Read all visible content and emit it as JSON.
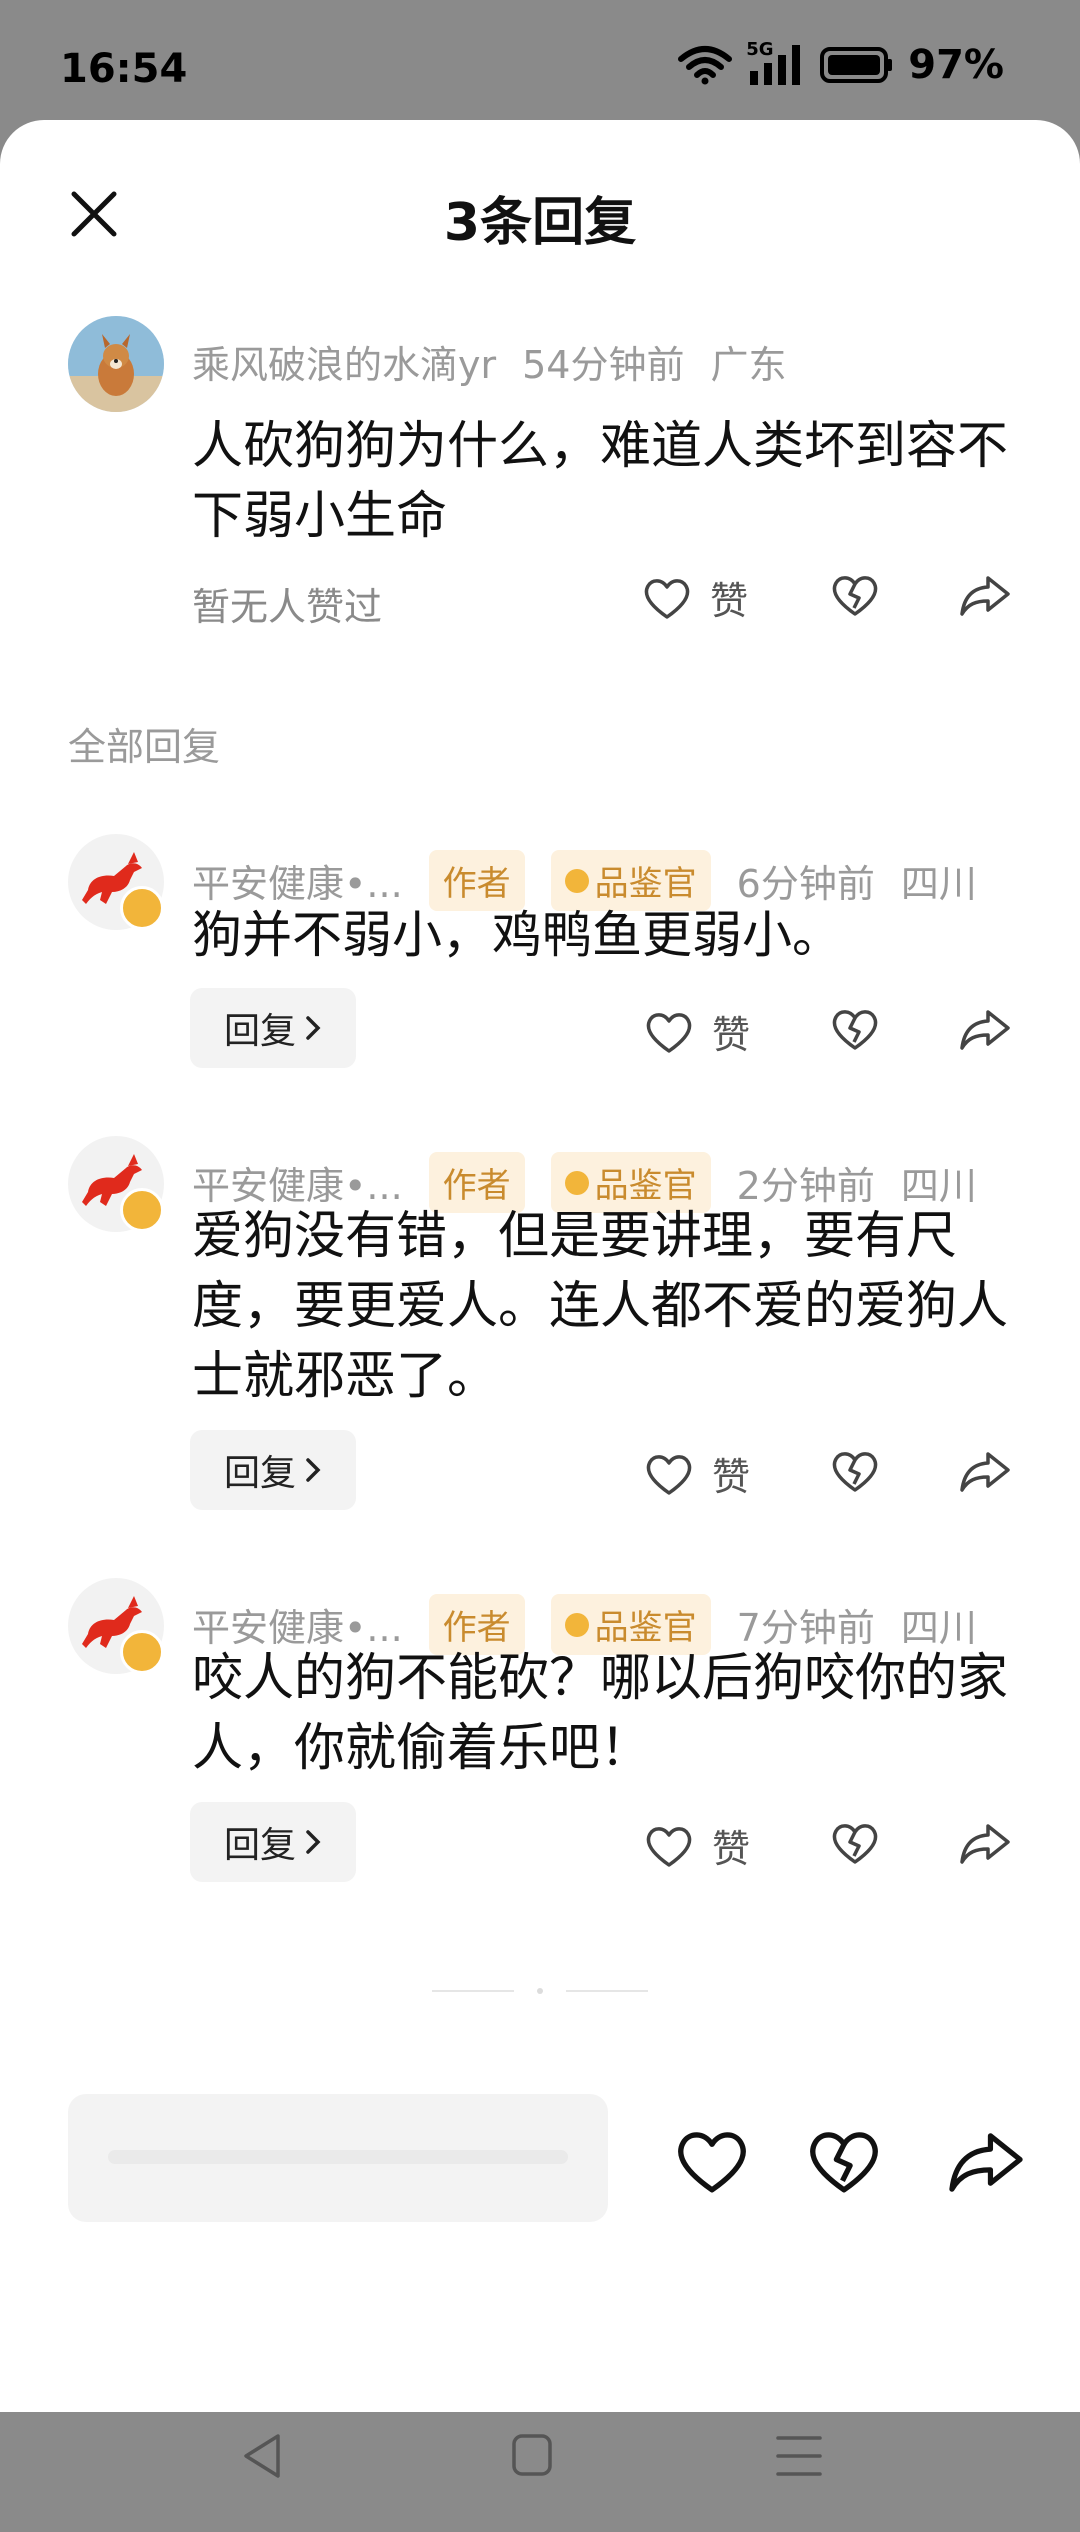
{
  "status": {
    "time": "16:54",
    "network": "5G",
    "battery": "97%"
  },
  "header": {
    "title": "3条回复"
  },
  "main_comment": {
    "user": "乘风破浪的水滴yr",
    "time": "54分钟前",
    "location": "广东",
    "text": "人砍狗狗为什么，难道人类坏到容不下弱小生命",
    "likes_note": "暂无人赞过",
    "like_label": "赞"
  },
  "section_label": "全部回复",
  "replies": [
    {
      "user": "平安健康•...",
      "tag_author": "作者",
      "tag_role": "品鉴官",
      "time": "6分钟前",
      "location": "四川",
      "text": "狗并不弱小，鸡鸭鱼更弱小。",
      "reply_label": "回复",
      "like_label": "赞"
    },
    {
      "user": "平安健康•...",
      "tag_author": "作者",
      "tag_role": "品鉴官",
      "time": "2分钟前",
      "location": "四川",
      "text": "爱狗没有错，但是要讲理，要有尺度，要更爱人。连人都不爱的爱狗人士就邪恶了。",
      "reply_label": "回复",
      "like_label": "赞"
    },
    {
      "user": "平安健康•...",
      "tag_author": "作者",
      "tag_role": "品鉴官",
      "time": "7分钟前",
      "location": "四川",
      "text": "咬人的狗不能砍？哪以后狗咬你的家人，你就偷着乐吧！",
      "reply_label": "回复",
      "like_label": "赞"
    }
  ],
  "colors": {
    "tag_text": "#c98b2e",
    "tag_bg": "#fdf1de",
    "badge": "#f2b53a",
    "horse_red": "#e02a1c"
  }
}
